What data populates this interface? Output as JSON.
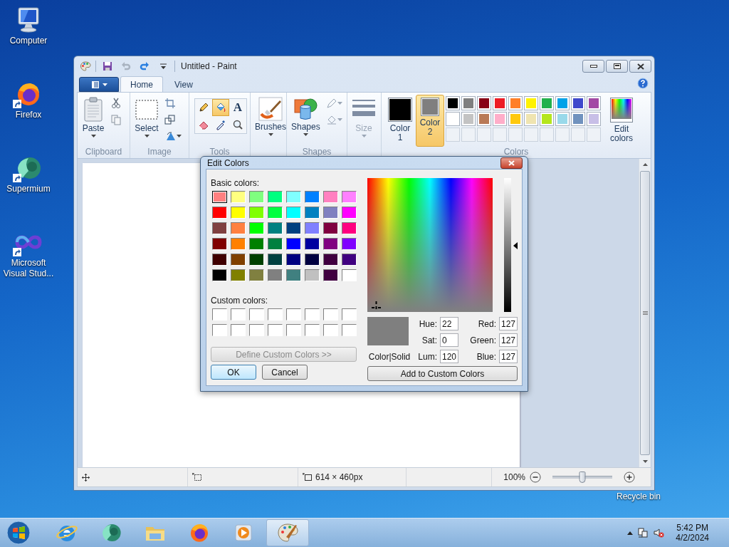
{
  "desktop_icons": [
    {
      "label": "Computer",
      "kind": "computer",
      "shortcut": false
    },
    {
      "label": "Firefox",
      "kind": "firefox",
      "shortcut": true
    },
    {
      "label": "Supermium",
      "kind": "supermium",
      "shortcut": true
    },
    {
      "label": "Microsoft Visual Stud...",
      "kind": "vs",
      "shortcut": true
    }
  ],
  "recycle_bin": {
    "label": "Recycle bin"
  },
  "paint": {
    "title": "Untitled - Paint",
    "quick_access": [
      {
        "kind": "save",
        "disabled": false
      },
      {
        "kind": "undo",
        "disabled": true
      },
      {
        "kind": "redo",
        "disabled": false
      }
    ],
    "tabs": [
      {
        "label": "Home",
        "selected": true
      },
      {
        "label": "View",
        "selected": false
      }
    ],
    "clipboard": {
      "paste": "Paste",
      "label": "Clipboard"
    },
    "image": {
      "select": "Select",
      "label": "Image"
    },
    "tools": {
      "label": "Tools",
      "items": [
        {
          "kind": "pencil",
          "selected": false
        },
        {
          "kind": "fill",
          "selected": true
        },
        {
          "kind": "text",
          "glyph": "A",
          "selected": false
        },
        {
          "kind": "eraser",
          "selected": false
        },
        {
          "kind": "picker",
          "selected": false
        },
        {
          "kind": "magnifier",
          "selected": false
        }
      ]
    },
    "brushes": {
      "label": "Brushes"
    },
    "shapes": {
      "button": "Shapes",
      "label": "Shapes"
    },
    "size": {
      "label": "Size",
      "disabled": true
    },
    "colors": {
      "label": "Colors",
      "edit": "Edit colors",
      "color1": {
        "label": "Color 1",
        "color": "#000000",
        "selected": false
      },
      "color2": {
        "label": "Color 2",
        "color": "#7f7f7f",
        "selected": true
      },
      "palette": [
        {
          "color": "#000000"
        },
        {
          "color": "#7f7f7f"
        },
        {
          "color": "#880015"
        },
        {
          "color": "#ed1c24"
        },
        {
          "color": "#ff7f27"
        },
        {
          "color": "#fff200"
        },
        {
          "color": "#22b14c"
        },
        {
          "color": "#00a2e8"
        },
        {
          "color": "#3f48cc"
        },
        {
          "color": "#a349a4"
        },
        {
          "color": "#ffffff"
        },
        {
          "color": "#c3c3c3"
        },
        {
          "color": "#b97a57"
        },
        {
          "color": "#ffaec9"
        },
        {
          "color": "#ffc90e"
        },
        {
          "color": "#efe4b0"
        },
        {
          "color": "#b5e61d"
        },
        {
          "color": "#99d9ea"
        },
        {
          "color": "#7092be"
        },
        {
          "color": "#c8bfe7"
        }
      ]
    },
    "status": {
      "canvas_size": "614 × 460px",
      "zoom": "100%",
      "zoom_slider": {
        "level": 0.5
      }
    }
  },
  "dialog": {
    "title": "Edit Colors",
    "basic_label": "Basic colors:",
    "basic_colors": [
      {
        "color": "#ff8080",
        "selected": true
      },
      {
        "color": "#ffff80",
        "selected": false
      },
      {
        "color": "#80ff80",
        "selected": false
      },
      {
        "color": "#00ff80",
        "selected": false
      },
      {
        "color": "#80ffff",
        "selected": false
      },
      {
        "color": "#0080ff",
        "selected": false
      },
      {
        "color": "#ff80c0",
        "selected": false
      },
      {
        "color": "#ff80ff",
        "selected": false
      },
      {
        "color": "#ff0000",
        "selected": false
      },
      {
        "color": "#ffff00",
        "selected": false
      },
      {
        "color": "#80ff00",
        "selected": false
      },
      {
        "color": "#00ff40",
        "selected": false
      },
      {
        "color": "#00ffff",
        "selected": false
      },
      {
        "color": "#0080c0",
        "selected": false
      },
      {
        "color": "#8080c0",
        "selected": false
      },
      {
        "color": "#ff00ff",
        "selected": false
      },
      {
        "color": "#804040",
        "selected": false
      },
      {
        "color": "#ff8040",
        "selected": false
      },
      {
        "color": "#00ff00",
        "selected": false
      },
      {
        "color": "#008080",
        "selected": false
      },
      {
        "color": "#004080",
        "selected": false
      },
      {
        "color": "#8080ff",
        "selected": false
      },
      {
        "color": "#800040",
        "selected": false
      },
      {
        "color": "#ff0080",
        "selected": false
      },
      {
        "color": "#800000",
        "selected": false
      },
      {
        "color": "#ff8000",
        "selected": false
      },
      {
        "color": "#008000",
        "selected": false
      },
      {
        "color": "#008040",
        "selected": false
      },
      {
        "color": "#0000ff",
        "selected": false
      },
      {
        "color": "#0000a0",
        "selected": false
      },
      {
        "color": "#800080",
        "selected": false
      },
      {
        "color": "#8000ff",
        "selected": false
      },
      {
        "color": "#400000",
        "selected": false
      },
      {
        "color": "#804000",
        "selected": false
      },
      {
        "color": "#004000",
        "selected": false
      },
      {
        "color": "#004040",
        "selected": false
      },
      {
        "color": "#000080",
        "selected": false
      },
      {
        "color": "#000040",
        "selected": false
      },
      {
        "color": "#400040",
        "selected": false
      },
      {
        "color": "#400080",
        "selected": false
      },
      {
        "color": "#000000",
        "selected": false
      },
      {
        "color": "#808000",
        "selected": false
      },
      {
        "color": "#808040",
        "selected": false
      },
      {
        "color": "#808080",
        "selected": false
      },
      {
        "color": "#408080",
        "selected": false
      },
      {
        "color": "#c0c0c0",
        "selected": false
      },
      {
        "color": "#400040",
        "selected": false
      },
      {
        "color": "#ffffff",
        "selected": false
      }
    ],
    "custom_label": "Custom colors:",
    "define": {
      "label": "Define Custom Colors >>",
      "disabled": true
    },
    "ok": "OK",
    "cancel": "Cancel",
    "preview": {
      "color": "#7f7f7f",
      "label": "Color|Solid"
    },
    "luminance": {
      "level": 0.5
    },
    "fields": [
      {
        "label": "Hue:",
        "value": "22"
      },
      {
        "label": "Red:",
        "value": "127"
      },
      {
        "label": "Sat:",
        "value": "0"
      },
      {
        "label": "Green:",
        "value": "127"
      },
      {
        "label": "Lum:",
        "value": "120"
      },
      {
        "label": "Blue:",
        "value": "127"
      }
    ],
    "add": "Add to Custom Colors"
  },
  "taskbar": {
    "apps": [
      {
        "kind": "ie",
        "selected": false
      },
      {
        "kind": "supermium",
        "selected": false
      },
      {
        "kind": "explorer",
        "selected": false
      },
      {
        "kind": "firefox",
        "selected": false
      },
      {
        "kind": "media",
        "selected": false
      },
      {
        "kind": "paint",
        "selected": true
      }
    ],
    "time": "5:42 PM",
    "date": "4/2/2024"
  }
}
